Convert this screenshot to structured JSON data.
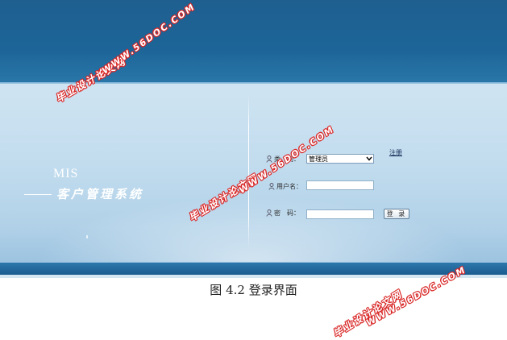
{
  "app": {
    "mis_title": "MIS",
    "system_name": "客户管理系统"
  },
  "form": {
    "category_label": "类　别：",
    "category_selected": "管理员",
    "username_label": "用户名：",
    "username_value": "",
    "password_label": "密　码：",
    "password_value": "",
    "register_link": "注册",
    "login_button": "登 录"
  },
  "caption": "图 4.2 登录界面",
  "watermarks": {
    "site_name": "毕业设计论文网",
    "site_url": "WWW.56DOC.COM"
  },
  "colors": {
    "banner": "#1d6598",
    "panel": "#c2dcee",
    "watermark_red": "#d92727"
  }
}
